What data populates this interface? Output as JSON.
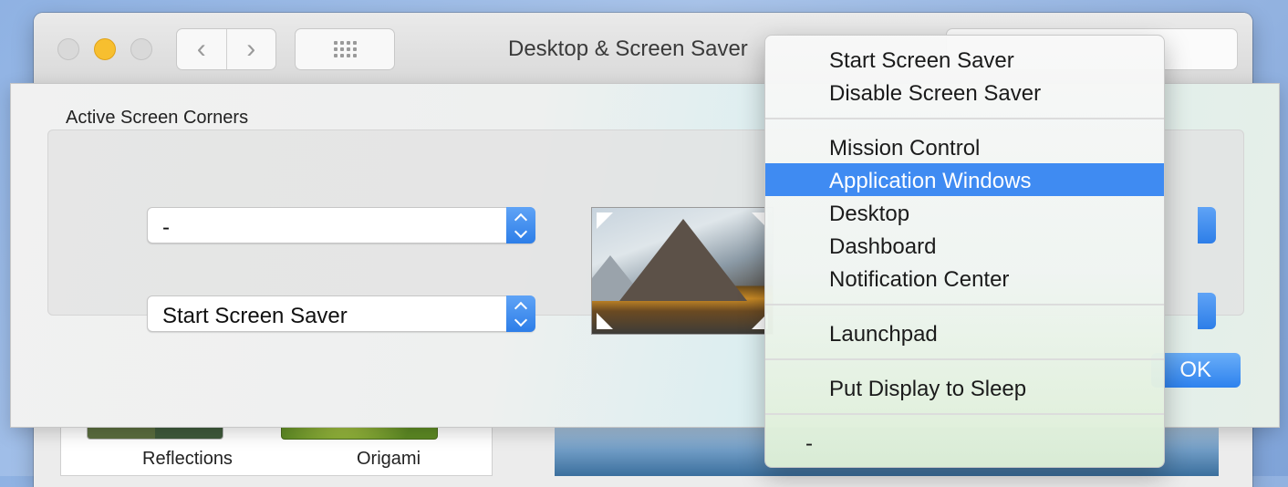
{
  "window": {
    "title": "Desktop & Screen Saver",
    "nav_back": "‹",
    "nav_forward": "›"
  },
  "background_thumbs": [
    {
      "label": "Reflections"
    },
    {
      "label": "Origami"
    }
  ],
  "sheet": {
    "title": "Active Screen Corners",
    "top_left_value": "-",
    "bottom_left_value": "Start Screen Saver",
    "ok_label": "OK"
  },
  "menu": {
    "groups": [
      [
        "Start Screen Saver",
        "Disable Screen Saver"
      ],
      [
        "Mission Control",
        "Application Windows",
        "Desktop",
        "Dashboard",
        "Notification Center"
      ],
      [
        "Launchpad"
      ],
      [
        "Put Display to Sleep"
      ],
      [
        "-"
      ]
    ],
    "selected": "Application Windows"
  },
  "colors": {
    "accent": "#3f8bf2",
    "minimize": "#f7bf2f"
  }
}
